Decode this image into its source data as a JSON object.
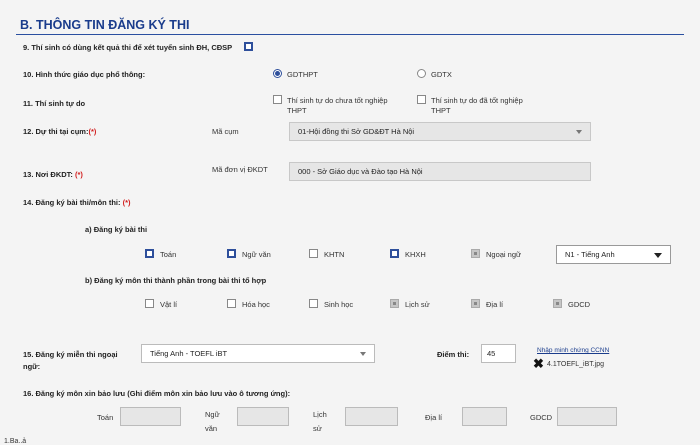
{
  "section_title": "B. THÔNG TIN ĐĂNG KÝ THI",
  "q9": {
    "label": "9. Thí sinh có dùng kết quả thi để xét tuyển sinh ĐH, CĐSP",
    "checked": true
  },
  "q10": {
    "label": "10. Hình thức giáo dục phổ thông:",
    "options": [
      "GDTHPT",
      "GDTX"
    ],
    "selected": "GDTHPT"
  },
  "q11": {
    "label": "11. Thí sinh tự do",
    "opt1_line1": "Thí sinh tự do chưa tốt nghiệp",
    "opt1_line2": "THPT",
    "opt2_line1": "Thí sinh tự do đã tốt nghiệp",
    "opt2_line2": "THPT"
  },
  "q12": {
    "label": "12. Dự thi tại cụm:",
    "required": "(*)",
    "field_label": "Mã cụm",
    "value": "01-Hội đồng thi Sở GD&ĐT Hà Nội"
  },
  "q13": {
    "label": "13. Nơi ĐKDT:",
    "required": "(*)",
    "field_label": "Mã đơn vị ĐKDT",
    "value": "000 - Sở Giáo dục và Đào tạo Hà Nội"
  },
  "q14": {
    "label": "14. Đăng ký bài thi/môn thi:",
    "required": "(*)",
    "a_label": "a) Đăng ký bài thi",
    "a_items": [
      {
        "label": "Toán",
        "state": "checked"
      },
      {
        "label": "Ngữ văn",
        "state": "checked"
      },
      {
        "label": "KHTN",
        "state": "unchecked"
      },
      {
        "label": "KHXH",
        "state": "checked"
      },
      {
        "label": "Ngoại ngữ",
        "state": "disabled"
      }
    ],
    "language_select": "N1 - Tiếng Anh",
    "b_label": "b) Đăng ký môn thi thành phần trong bài thi tổ hợp",
    "b_items": [
      {
        "label": "Vật lí",
        "state": "unchecked"
      },
      {
        "label": "Hóa học",
        "state": "unchecked"
      },
      {
        "label": "Sinh học",
        "state": "unchecked"
      },
      {
        "label": "Lịch sử",
        "state": "disabled"
      },
      {
        "label": "Địa lí",
        "state": "disabled"
      },
      {
        "label": "GDCD",
        "state": "disabled"
      }
    ]
  },
  "q15": {
    "label_line1": "15. Đăng ký miễn thi ngoại",
    "label_line2": "ngữ:",
    "select_value": "Tiếng Anh - TOEFL iBT",
    "score_label": "Điểm thi:",
    "score_value": "45",
    "evidence_link": "Nhập minh chứng CCNN",
    "file_name": "4.1TOEFL_iBT.jpg"
  },
  "q16": {
    "label": "16. Đăng ký môn xin bảo lưu (Ghi điểm môn xin bảo lưu vào ô tương ứng):",
    "fields": [
      "Toán",
      "Ngữ",
      "văn",
      "Lịch",
      "sử",
      "Địa lí",
      "GDCD"
    ]
  },
  "footnote": "1.Ba..ả"
}
